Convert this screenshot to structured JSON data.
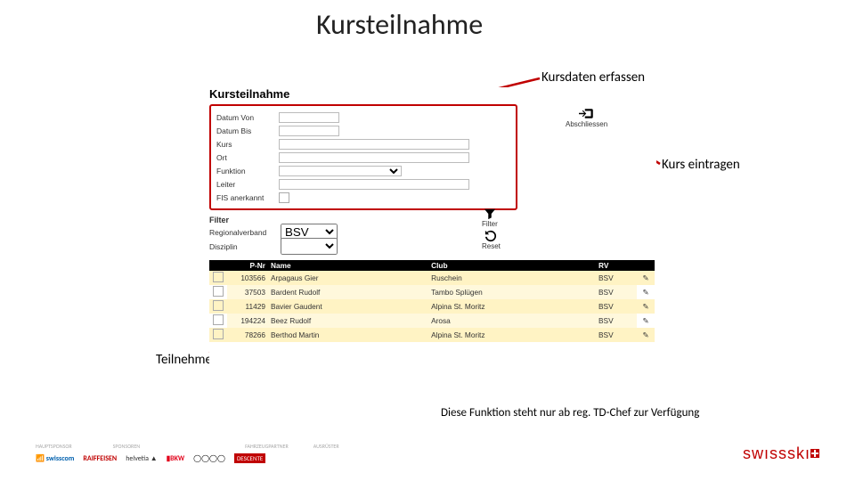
{
  "title": "Kursteilnahme",
  "callouts": {
    "kursdaten": "Kursdaten erfassen",
    "eintragen": "Kurs eintragen",
    "teilnehmer": "Teilnehmer auswählen"
  },
  "note": "Diese Funktion steht nur ab reg. TD-Chef zur Verfügung",
  "app": {
    "heading": "Kursteilnahme",
    "form": {
      "datum_von": "Datum Von",
      "datum_bis": "Datum Bis",
      "kurs": "Kurs",
      "ort": "Ort",
      "funktion": "Funktion",
      "leiter": "Leiter",
      "fis": "FIS anerkannt"
    },
    "abschliessen": "Abschliessen",
    "filter_heading": "Filter",
    "filter": {
      "regionalverband": "Regionalverband",
      "disziplin": "Disziplin",
      "rv_value": "BSV"
    },
    "filter_icon": "Filter",
    "reset_icon": "Reset",
    "table": {
      "headers": {
        "pnr": "P-Nr",
        "name": "Name",
        "club": "Club",
        "rv": "RV",
        "edit": ""
      },
      "rows": [
        {
          "pnr": "103566",
          "name": "Arpagaus Gier",
          "club": "Ruschein",
          "rv": "BSV"
        },
        {
          "pnr": "37503",
          "name": "Bardent Rudolf",
          "club": "Tambo Splügen",
          "rv": "BSV"
        },
        {
          "pnr": "11429",
          "name": "Bavier Gaudent",
          "club": "Alpina St. Moritz",
          "rv": "BSV"
        },
        {
          "pnr": "194224",
          "name": "Beez Rudolf",
          "club": "Arosa",
          "rv": "BSV"
        },
        {
          "pnr": "78266",
          "name": "Berthod Martin",
          "club": "Alpina St. Moritz",
          "rv": "BSV"
        }
      ]
    }
  },
  "footer": {
    "hauptsponsor": "HAUPTSPONSOR",
    "sponsoren": "SPONSOREN",
    "fahrzeug": "FAHRZEUGPARTNER",
    "ausruester": "AUSRÜSTER",
    "swisscom": "swisscom",
    "raiffeisen": "RAIFFEISEN",
    "helvetia": "helvetia",
    "bkw": "BKW",
    "audi": "Audi",
    "descente": "DESCENTE",
    "brand": "swıssskı"
  }
}
